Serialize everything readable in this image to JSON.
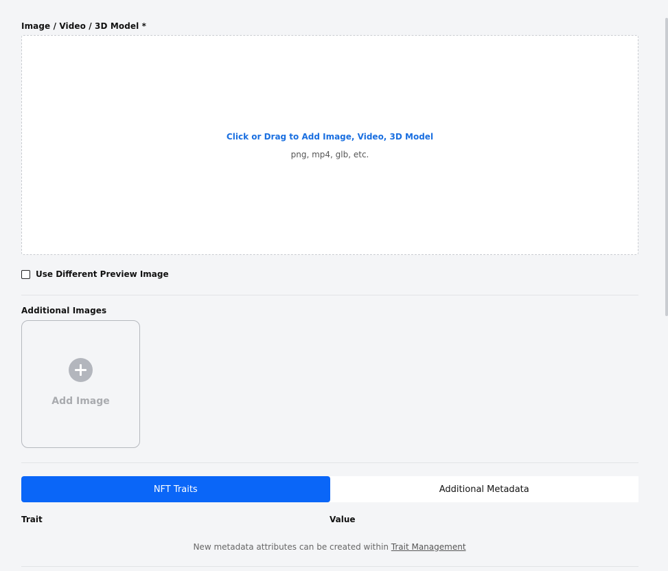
{
  "media": {
    "label": "Image / Video / 3D Model *",
    "dropzone_title": "Click or Drag to Add Image, Video, 3D Model",
    "dropzone_formats": "png, mp4, glb, etc."
  },
  "preview": {
    "checkbox_label": "Use Different Preview Image",
    "checked": false
  },
  "additional_images": {
    "label": "Additional Images",
    "add_label": "Add Image"
  },
  "tabs": [
    {
      "label": "NFT Traits",
      "active": true
    },
    {
      "label": "Additional Metadata",
      "active": false
    }
  ],
  "traits_table": {
    "columns": [
      "Trait",
      "Value"
    ]
  },
  "footnote": {
    "text": "New metadata attributes can be created within",
    "link": "Trait Management"
  },
  "colors": {
    "accent": "#0a66f8",
    "link_blue": "#1a6fe0"
  }
}
